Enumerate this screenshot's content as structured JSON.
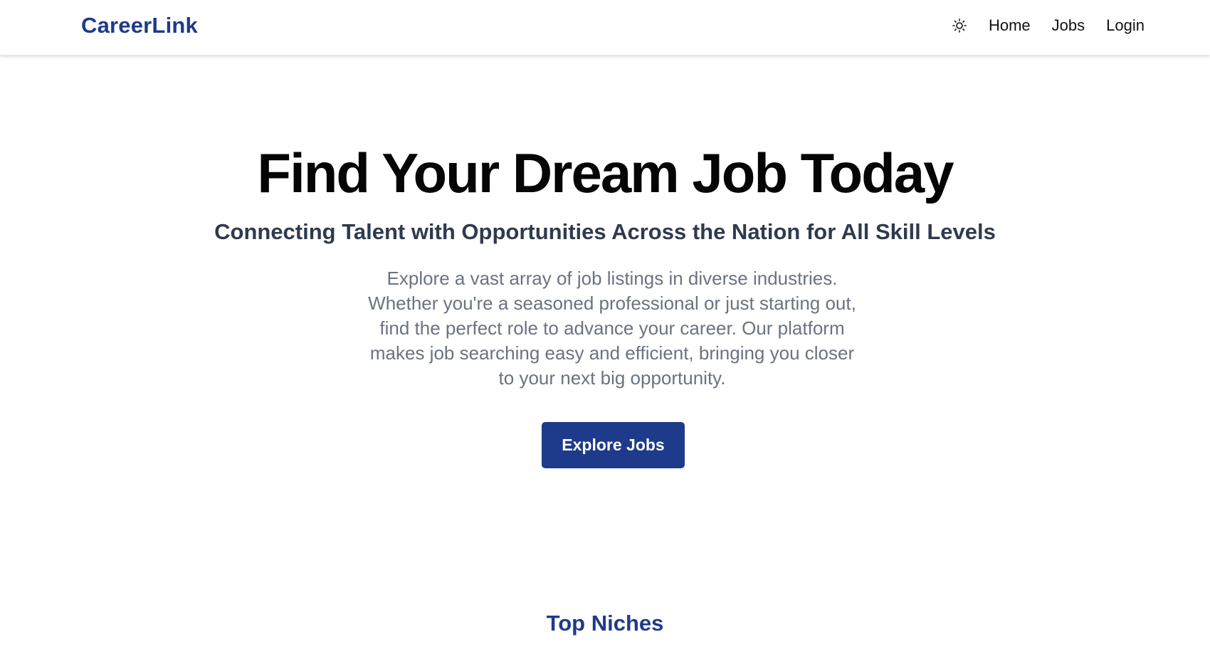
{
  "navbar": {
    "brand": "CareerLink",
    "theme_icon": "sun-icon",
    "links": [
      "Home",
      "Jobs",
      "Login"
    ]
  },
  "hero": {
    "title": "Find Your Dream Job Today",
    "subtitle": "Connecting Talent with Opportunities Across the Nation for All Skill Levels",
    "description_lines": [
      "Explore a vast array of job listings in diverse industries.",
      "Whether you're a seasoned professional or just starting out,",
      "find the perfect role to advance your career. Our platform",
      "makes job searching easy and efficient, bringing you closer",
      "to your next big opportunity."
    ],
    "cta_label": "Explore Jobs"
  },
  "sections": {
    "top_niches_title": "Top Niches"
  },
  "colors": {
    "brand": "#1e3a8a",
    "title": "#050505",
    "subtitle": "#2f3a4d",
    "body_text": "#6b7280",
    "background": "#ffffff"
  }
}
